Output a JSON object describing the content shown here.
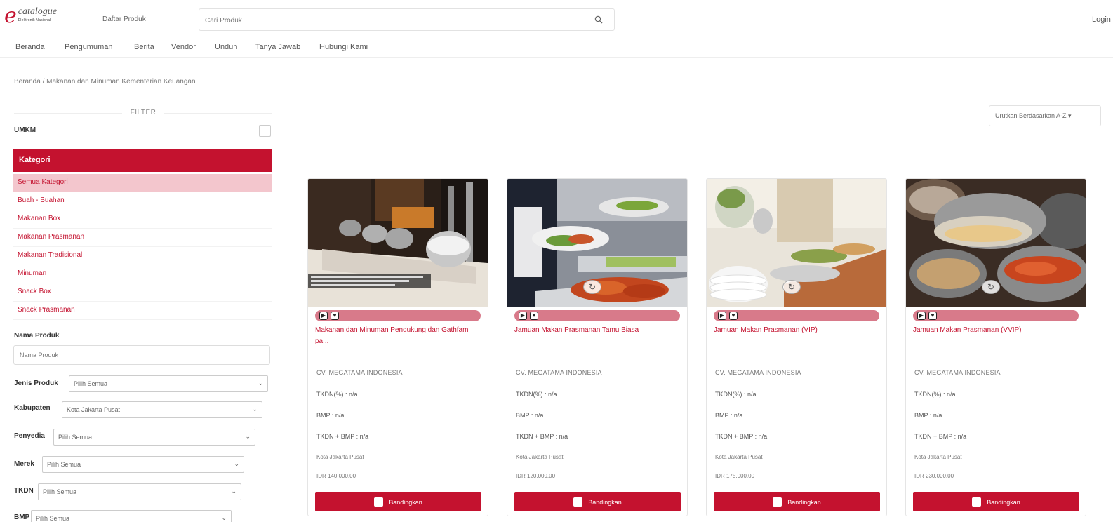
{
  "header": {
    "logo_text": "catalogue",
    "logo_subtext": "Elektronik Nasional",
    "daftar_label": "Daftar Produk",
    "search_placeholder": "Cari Produk",
    "login_label": "Login"
  },
  "nav": [
    "Beranda",
    "Pengumuman",
    "Berita",
    "Vendor",
    "Unduh",
    "Tanya Jawab",
    "Hubungi Kami"
  ],
  "breadcrumb": "Beranda / Makanan dan Minuman Kementerian Keuangan",
  "sidebar": {
    "filter_title": "FILTER",
    "umkm_label": "UMKM",
    "kategori_label": "Kategori",
    "kategori_items": [
      "Semua Kategori",
      "Buah - Buahan",
      "Makanan Box",
      "Makanan Prasmanan",
      "Makanan Tradisional",
      "Minuman",
      "Snack Box",
      "Snack Prasmanan"
    ],
    "nama_produk_label": "Nama Produk",
    "nama_produk_placeholder": "Nama Produk",
    "selects": [
      {
        "label": "Jenis Produk",
        "value": "Pilih Semua"
      },
      {
        "label": "Kabupaten",
        "value": "Kota Jakarta Pusat"
      },
      {
        "label": "Penyedia",
        "value": "Pilih Semua"
      },
      {
        "label": "Merek",
        "value": "Pilih Semua"
      },
      {
        "label": "TKDN",
        "value": "Pilih Semua"
      },
      {
        "label": "BMP",
        "value": "Pilih Semua"
      }
    ]
  },
  "sort_label": "Urutkan Berdasarkan A-Z ▾",
  "products": [
    {
      "title": "Makanan dan Minuman Pendukung dan Gathfam pa...",
      "vendor": "CV. MEGATAMA INDONESIA",
      "tkdn": "TKDN(%) : n/a",
      "bmp": "BMP : n/a",
      "tkdn_bmp": "TKDN + BMP : n/a",
      "location": "Kota Jakarta Pusat",
      "price": "IDR 140.000,00",
      "compare_label": "Bandingkan"
    },
    {
      "title": "Jamuan Makan Prasmanan Tamu Biasa",
      "vendor": "CV. MEGATAMA INDONESIA",
      "tkdn": "TKDN(%) : n/a",
      "bmp": "BMP : n/a",
      "tkdn_bmp": "TKDN + BMP : n/a",
      "location": "Kota Jakarta Pusat",
      "price": "IDR 120.000,00",
      "compare_label": "Bandingkan"
    },
    {
      "title": "Jamuan Makan Prasmanan (VIP)",
      "vendor": "CV. MEGATAMA INDONESIA",
      "tkdn": "TKDN(%) : n/a",
      "bmp": "BMP : n/a",
      "tkdn_bmp": "TKDN + BMP : n/a",
      "location": "Kota Jakarta Pusat",
      "price": "IDR 175.000,00",
      "compare_label": "Bandingkan"
    },
    {
      "title": "Jamuan Makan Prasmanan (VVIP)",
      "vendor": "CV. MEGATAMA INDONESIA",
      "tkdn": "TKDN(%) : n/a",
      "bmp": "BMP : n/a",
      "tkdn_bmp": "TKDN + BMP : n/a",
      "location": "Kota Jakarta Pusat",
      "price": "IDR 230.000,00",
      "compare_label": "Bandingkan"
    }
  ],
  "colors": {
    "brand_red": "#c4122f",
    "active_category_bg": "#f3c6cd",
    "pill_bg": "#d87a8a"
  }
}
